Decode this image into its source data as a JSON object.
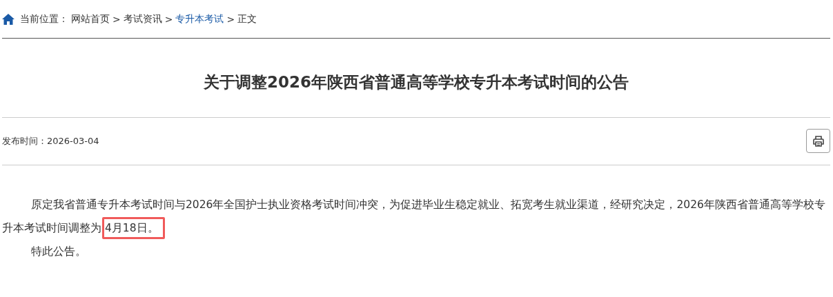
{
  "breadcrumb": {
    "label": "当前位置：",
    "items": [
      {
        "text": "网站首页",
        "current": false
      },
      {
        "text": "考试资讯",
        "current": false
      },
      {
        "text": "专升本考试",
        "current": true
      },
      {
        "text": "正文",
        "current": false
      }
    ],
    "separator": ">"
  },
  "article": {
    "title": "关于调整2026年陕西省普通高等学校专升本考试时间的公告",
    "publish_label": "发布时间：",
    "publish_date": "2026-03-04",
    "paragraphs": [
      {
        "segments": [
          {
            "text": "原定我省普通专升本考试时间与2026年全国护士执业资格考试时间冲突，为促进毕业生稳定就业、拓宽考生就业渠道，经研究决定，2026年陕西省普通高等学校专升本考试时间调整为",
            "highlighted": false
          },
          {
            "text": "4月18日。",
            "highlighted": true
          }
        ]
      },
      {
        "segments": [
          {
            "text": "特此公告。",
            "highlighted": false
          }
        ]
      }
    ]
  }
}
